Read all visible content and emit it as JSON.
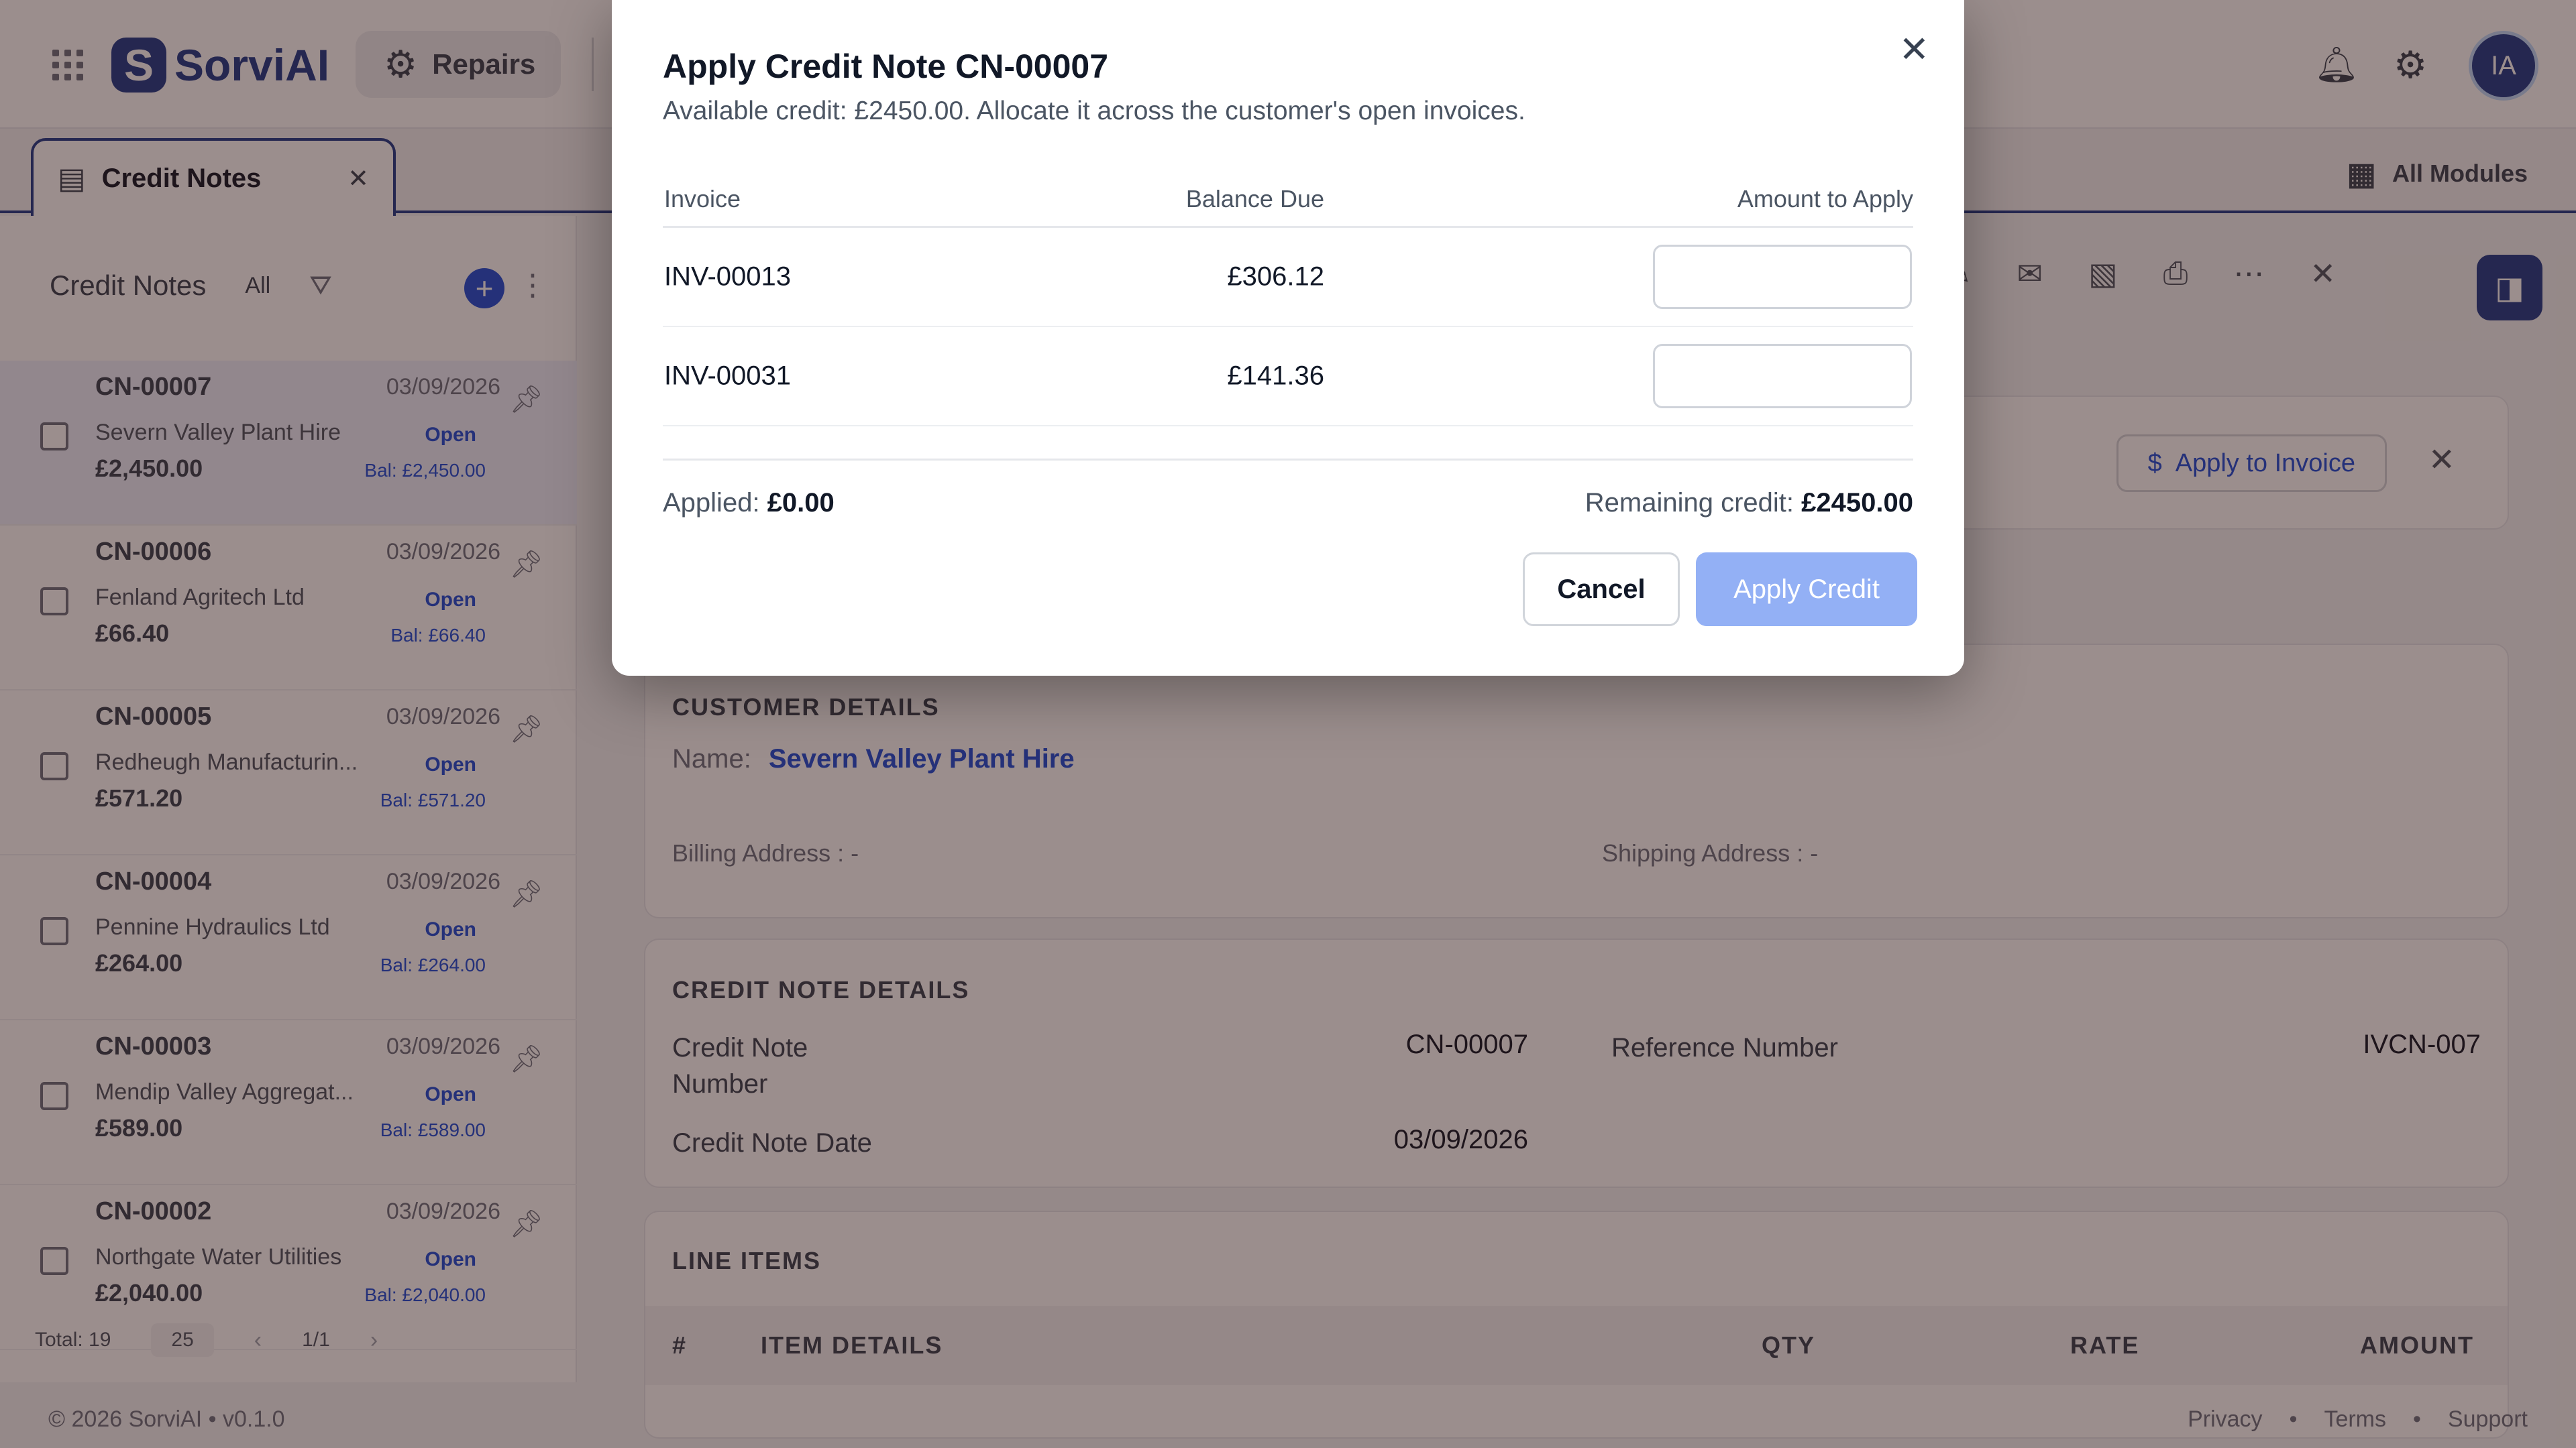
{
  "app": {
    "name": "SorviAI",
    "logo_letter": "S",
    "module": "Repairs",
    "user_initials": "IA",
    "accent": "#1e3a8a"
  },
  "tabs": [
    {
      "label": "Credit Notes"
    }
  ],
  "all_modules_label": "All Modules",
  "sidebar": {
    "title": "Credit Notes",
    "filter_label": "All",
    "items": [
      {
        "number": "CN-00007",
        "date": "03/09/2026",
        "customer": "Severn Valley Plant Hire",
        "status": "Open",
        "amount": "£2,450.00",
        "balance": "Bal: £2,450.00"
      },
      {
        "number": "CN-00006",
        "date": "03/09/2026",
        "customer": "Fenland Agritech Ltd",
        "status": "Open",
        "amount": "£66.40",
        "balance": "Bal: £66.40"
      },
      {
        "number": "CN-00005",
        "date": "03/09/2026",
        "customer": "Redheugh Manufacturin...",
        "status": "Open",
        "amount": "£571.20",
        "balance": "Bal: £571.20"
      },
      {
        "number": "CN-00004",
        "date": "03/09/2026",
        "customer": "Pennine Hydraulics Ltd",
        "status": "Open",
        "amount": "£264.00",
        "balance": "Bal: £264.00"
      },
      {
        "number": "CN-00003",
        "date": "03/09/2026",
        "customer": "Mendip Valley Aggregat...",
        "status": "Open",
        "amount": "£589.00",
        "balance": "Bal: £589.00"
      },
      {
        "number": "CN-00002",
        "date": "03/09/2026",
        "customer": "Northgate Water Utilities",
        "status": "Open",
        "amount": "£2,040.00",
        "balance": "Bal: £2,040.00"
      }
    ],
    "footer": {
      "total": "Total: 19",
      "per_page": "25",
      "page": "1/1"
    }
  },
  "page_footer": {
    "copyright": "© 2026 SorviAI  •  v0.1.0",
    "links": [
      "Privacy",
      "•",
      "Terms",
      "•",
      "Support"
    ]
  },
  "detail": {
    "apply_to_invoice_label": "Apply to Invoice",
    "customer_section": "CUSTOMER DETAILS",
    "name_label": "Name:",
    "customer_name": "Severn Valley Plant Hire",
    "billing_label": "Billing Address   :  -",
    "shipping_label": "Shipping Address   :  -",
    "cn_section": "CREDIT NOTE DETAILS",
    "cn_number_label": "Credit Note Number",
    "cn_number": "CN-00007",
    "reference_label": "Reference Number",
    "reference": "IVCN-007",
    "cn_date_label": "Credit Note Date",
    "cn_date": "03/09/2026",
    "line_items_section": "LINE ITEMS",
    "line_cols": [
      "#",
      "ITEM DETAILS",
      "QTY",
      "RATE",
      "AMOUNT"
    ]
  },
  "modal": {
    "title": "Apply Credit Note CN-00007",
    "subtitle": "Available credit: £2450.00. Allocate it across the customer's open invoices.",
    "columns": {
      "invoice": "Invoice",
      "balance": "Balance Due",
      "amount": "Amount to Apply"
    },
    "rows": [
      {
        "invoice": "INV-00013",
        "balance": "£306.12",
        "amount": ""
      },
      {
        "invoice": "INV-00031",
        "balance": "£141.36",
        "amount": ""
      }
    ],
    "applied_label": "Applied:",
    "applied_value": "£0.00",
    "remaining_label": "Remaining credit:",
    "remaining_value": "£2450.00",
    "cancel_label": "Cancel",
    "apply_label": "Apply Credit"
  }
}
